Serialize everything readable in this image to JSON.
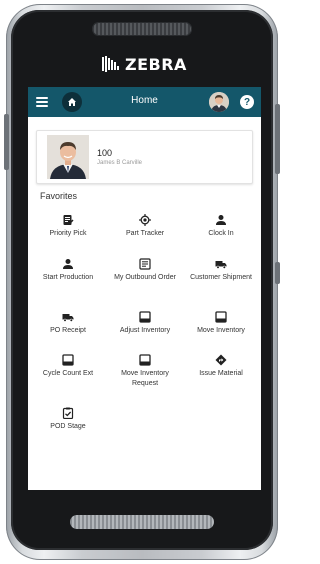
{
  "device": {
    "brand_logo_text": "ZEBRA"
  },
  "topbar": {
    "title": "Home",
    "help_label": "?",
    "colors": {
      "bar": "#14576a",
      "home_button": "#0d2f3a"
    }
  },
  "profile": {
    "id": "100",
    "name": "James B Carville"
  },
  "favorites": {
    "title": "Favorites",
    "items": [
      {
        "label": "Priority Pick",
        "icon": "clipboard-list-icon"
      },
      {
        "label": "Part Tracker",
        "icon": "crosshair-target-icon"
      },
      {
        "label": "Clock In",
        "icon": "person-icon"
      },
      {
        "label": "Start Production",
        "icon": "person-icon"
      },
      {
        "label": "My Outbound Order",
        "icon": "list-document-icon"
      },
      {
        "label": "Customer Shipment",
        "icon": "truck-icon"
      },
      {
        "label": "PO Receipt",
        "icon": "truck-icon"
      },
      {
        "label": "Adjust Inventory",
        "icon": "inbox-tray-icon"
      },
      {
        "label": "Move Inventory",
        "icon": "inbox-tray-icon"
      },
      {
        "label": "Cycle Count Ext",
        "icon": "inbox-tray-icon"
      },
      {
        "label": "Move Inventory Request",
        "icon": "inbox-tray-icon"
      },
      {
        "label": "Issue Material",
        "icon": "diamond-direction-icon"
      },
      {
        "label": "POD Stage",
        "icon": "clipboard-check-icon"
      }
    ]
  }
}
